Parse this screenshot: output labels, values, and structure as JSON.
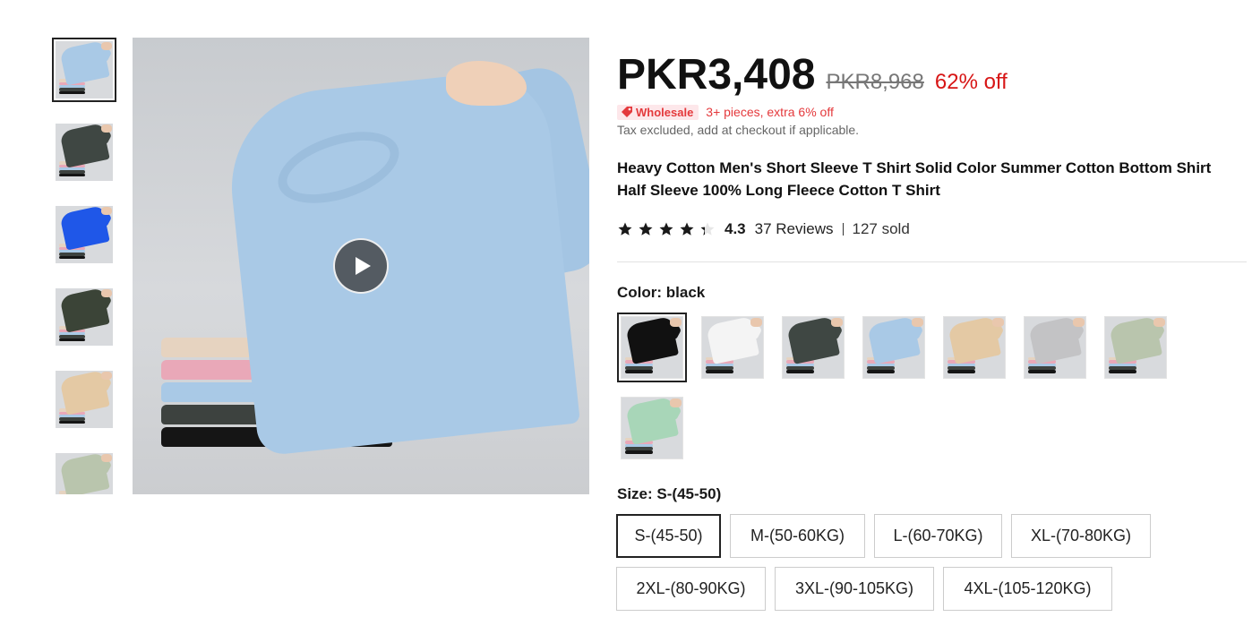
{
  "gallery": {
    "thumbnails": [
      {
        "color": "#a9c9e6",
        "active": true
      },
      {
        "color": "#3f4743",
        "active": false
      },
      {
        "color": "#1f57e8",
        "active": false
      },
      {
        "color": "#3b4437",
        "active": false
      },
      {
        "color": "#e4c9a4",
        "active": false
      },
      {
        "color": "#b9c5ad",
        "active": false
      }
    ],
    "main_color": "#a9c9e6",
    "play_icon": "play-icon"
  },
  "price": {
    "current": "PKR3,408",
    "original": "PKR8,968",
    "discount": "62% off"
  },
  "wholesale": {
    "badge": "Wholesale",
    "badge_icon": "tag-icon",
    "offer": "3+ pieces, extra 6% off"
  },
  "tax_note": "Tax excluded, add at checkout if applicable.",
  "product": {
    "title": "Heavy Cotton Men's Short Sleeve T Shirt Solid Color Summer Cotton Bottom Shirt Half Sleeve 100% Long Fleece Cotton T Shirt"
  },
  "rating": {
    "score": "4.3",
    "score_value": 4.3,
    "max": 5,
    "reviews": "37 Reviews",
    "sold": "127 sold"
  },
  "color": {
    "label": "Color:",
    "selected": "black",
    "swatches": [
      {
        "color": "#111111",
        "active": true
      },
      {
        "color": "#f4f4f4",
        "active": false
      },
      {
        "color": "#3f4743",
        "active": false
      },
      {
        "color": "#a9c9e6",
        "active": false
      },
      {
        "color": "#e4c9a4",
        "active": false
      },
      {
        "color": "#c3c3c5",
        "active": false
      },
      {
        "color": "#b9c5ad",
        "active": false
      },
      {
        "color": "#a8d6b8",
        "active": false
      }
    ]
  },
  "size": {
    "label": "Size:",
    "selected": "S-(45-50)",
    "options": [
      {
        "label": "S-(45-50)",
        "active": true
      },
      {
        "label": "M-(50-60KG)",
        "active": false
      },
      {
        "label": "L-(60-70KG)",
        "active": false
      },
      {
        "label": "XL-(70-80KG)",
        "active": false
      },
      {
        "label": "2XL-(80-90KG)",
        "active": false
      },
      {
        "label": "3XL-(90-105KG)",
        "active": false
      },
      {
        "label": "4XL-(105-120KG)",
        "active": false
      }
    ]
  },
  "stack_colors": [
    "#e6d3c0",
    "#e9a8b8",
    "#a9c9e6",
    "#3d423f",
    "#151515"
  ]
}
